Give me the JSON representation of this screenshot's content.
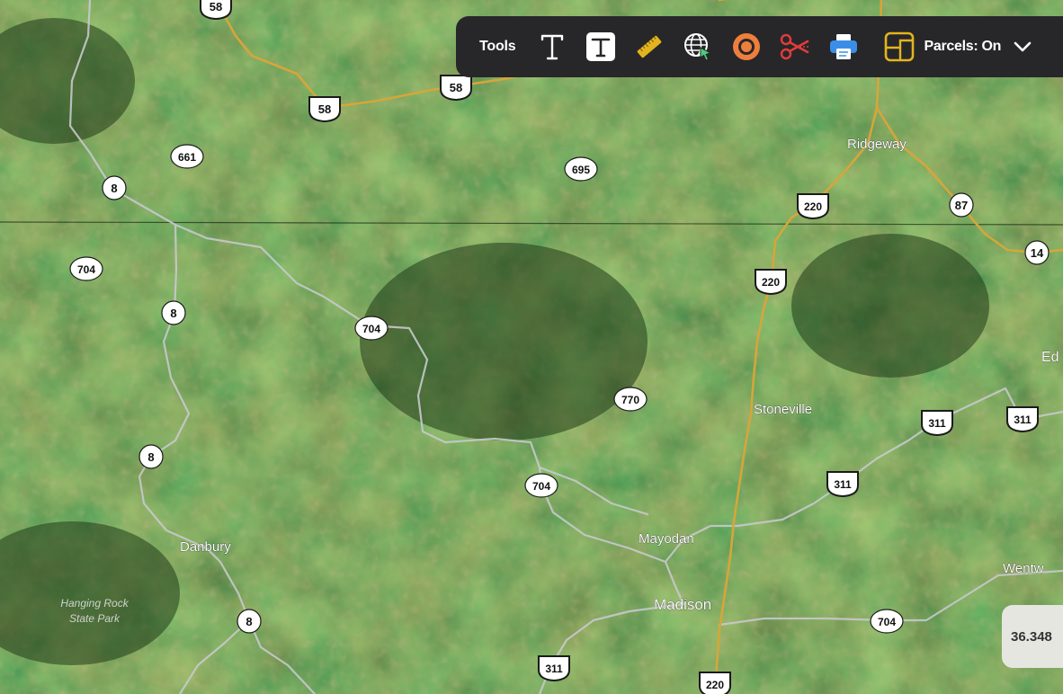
{
  "toolbar": {
    "label": "Tools",
    "tools": [
      {
        "name": "text-tool",
        "icon": "text-icon"
      },
      {
        "name": "text-box-tool",
        "icon": "text-box-icon"
      },
      {
        "name": "measure-tool",
        "icon": "ruler-icon"
      },
      {
        "name": "globe-tool",
        "icon": "globe-cursor-icon"
      },
      {
        "name": "radius-tool",
        "icon": "target-icon"
      },
      {
        "name": "cut-tool",
        "icon": "scissors-icon"
      },
      {
        "name": "print-tool",
        "icon": "printer-icon"
      }
    ],
    "parcels_label": "Parcels: On",
    "accent_yellow": "#e3b41e",
    "accent_red": "#e23b3b",
    "accent_blue": "#3b8ee8",
    "accent_orange": "#ee7e3c"
  },
  "map": {
    "places": [
      {
        "name": "Ridgeway"
      },
      {
        "name": "Stoneville"
      },
      {
        "name": "Mayodan"
      },
      {
        "name": "Madison"
      },
      {
        "name": "Danbury"
      },
      {
        "name": "Wentw"
      },
      {
        "name": "Ed"
      }
    ],
    "park": [
      "Hanging Rock",
      "State Park"
    ],
    "shields": [
      "58",
      "58",
      "58",
      "661",
      "695",
      "8",
      "220",
      "87",
      "14",
      "704",
      "220",
      "8",
      "704",
      "770",
      "311",
      "311",
      "8",
      "704",
      "311",
      "704",
      "8",
      "311",
      "220"
    ]
  },
  "coordinate": {
    "text": "36.348"
  }
}
